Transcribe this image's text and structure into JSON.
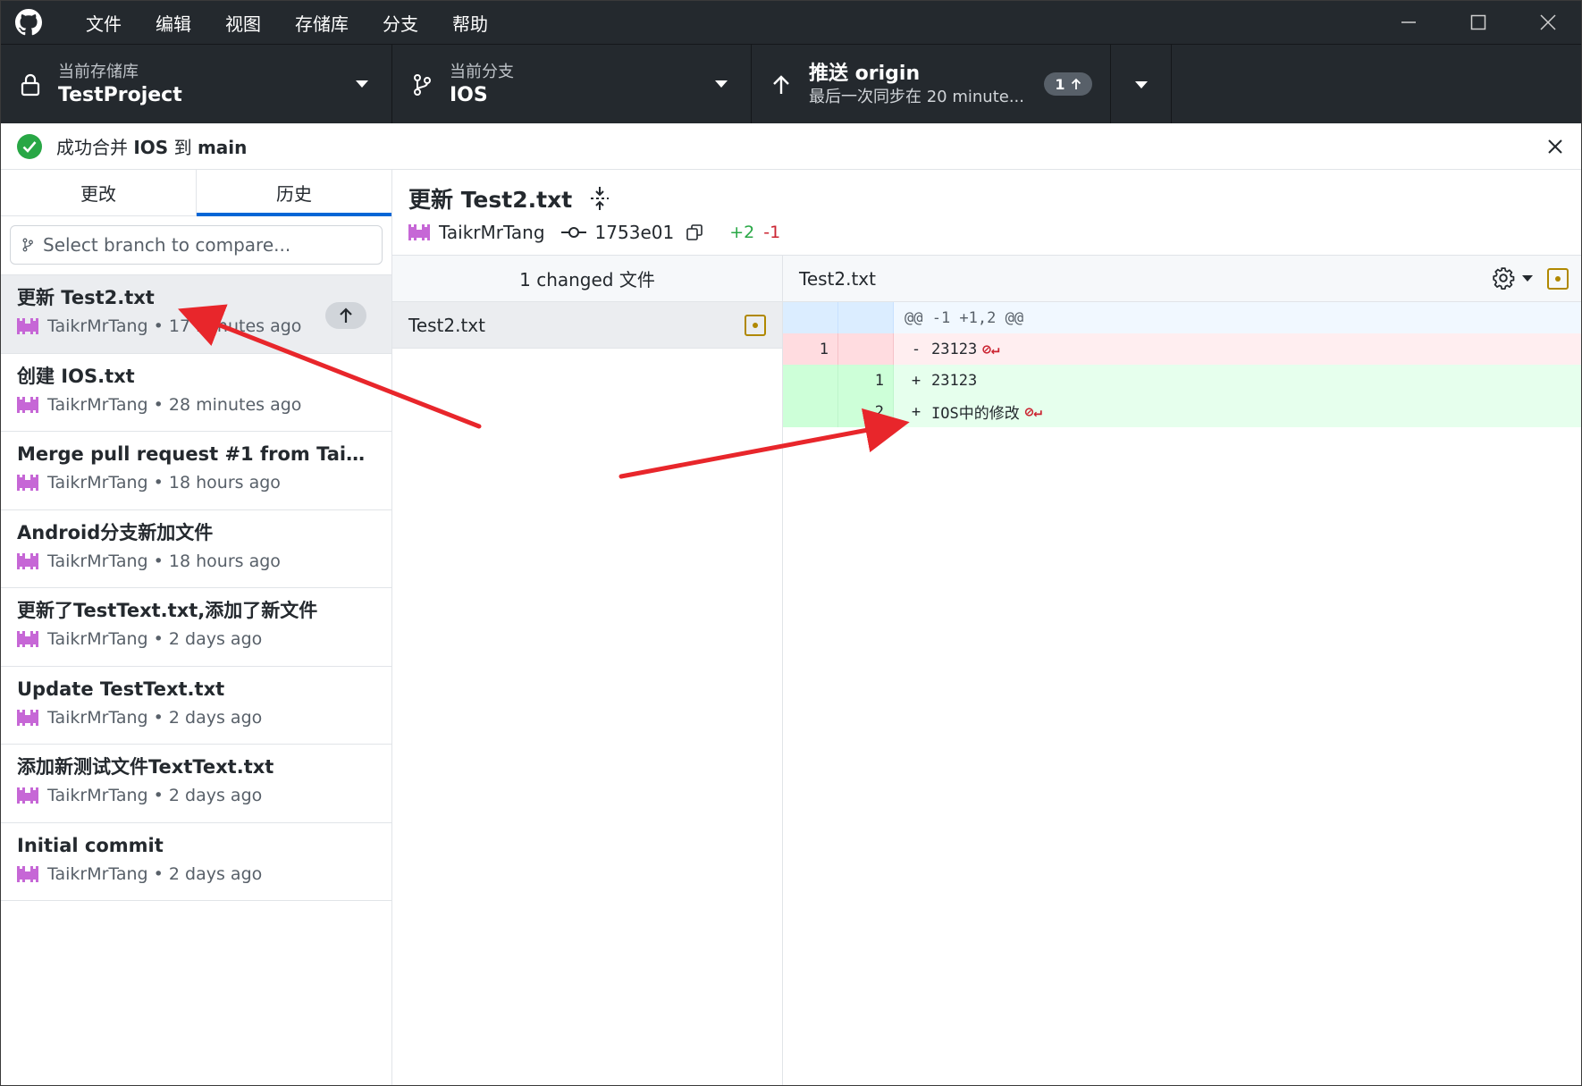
{
  "menu": {
    "items": [
      "文件",
      "编辑",
      "视图",
      "存储库",
      "分支",
      "帮助"
    ]
  },
  "toolbar": {
    "repo_label": "当前存储库",
    "repo_name": "TestProject",
    "branch_label": "当前分支",
    "branch_name": "IOS",
    "push_title": "推送 origin",
    "push_subtitle": "最后一次同步在 20 minute...",
    "push_count": "1"
  },
  "banner": {
    "prefix": "成功合并 ",
    "from_branch": "IOS",
    "middle": " 到 ",
    "to_branch": "main"
  },
  "sidebar": {
    "tabs": [
      "更改",
      "历史"
    ],
    "active_tab": "历史",
    "compare_placeholder": "Select branch to compare...",
    "commits": [
      {
        "title": "更新 Test2.txt",
        "author": "TaikrMrTang",
        "time": "17 minutes ago",
        "unpushed": true
      },
      {
        "title": "创建 IOS.txt",
        "author": "TaikrMrTang",
        "time": "28 minutes ago"
      },
      {
        "title": "Merge pull request #1 from TaikrM...",
        "author": "TaikrMrTang",
        "time": "18 hours ago"
      },
      {
        "title": "Android分支新加文件",
        "author": "TaikrMrTang",
        "time": "18 hours ago"
      },
      {
        "title": "更新了TestText.txt,添加了新文件",
        "author": "TaikrMrTang",
        "time": "2 days ago"
      },
      {
        "title": "Update TestText.txt",
        "author": "TaikrMrTang",
        "time": "2 days ago"
      },
      {
        "title": "添加新测试文件TextText.txt",
        "author": "TaikrMrTang",
        "time": "2 days ago"
      },
      {
        "title": "Initial commit",
        "author": "TaikrMrTang",
        "time": "2 days ago"
      }
    ]
  },
  "commit": {
    "title": "更新 Test2.txt",
    "author": "TaikrMrTang",
    "sha": "1753e01",
    "additions": "+2",
    "deletions": "-1"
  },
  "files": {
    "header": "1 changed 文件",
    "items": [
      "Test2.txt"
    ]
  },
  "diff": {
    "filename": "Test2.txt",
    "hunk": "@@ -1 +1,2 @@",
    "lines": [
      {
        "type": "del",
        "old": "1",
        "new": "",
        "sign": "-",
        "text": "23123",
        "no_eol": true
      },
      {
        "type": "add",
        "old": "",
        "new": "1",
        "sign": "+",
        "text": "23123",
        "no_eol": false
      },
      {
        "type": "add",
        "old": "",
        "new": "2",
        "sign": "+",
        "text": "IOS中的修改",
        "no_eol": true
      }
    ],
    "no_eol_marker": "⊘↵"
  },
  "colors": {
    "toolbar_bg": "#24292e",
    "accent_blue": "#0366d6",
    "success_green": "#28a745",
    "annotation_red": "#e8262b",
    "avatar_purple": "#c667d6"
  }
}
